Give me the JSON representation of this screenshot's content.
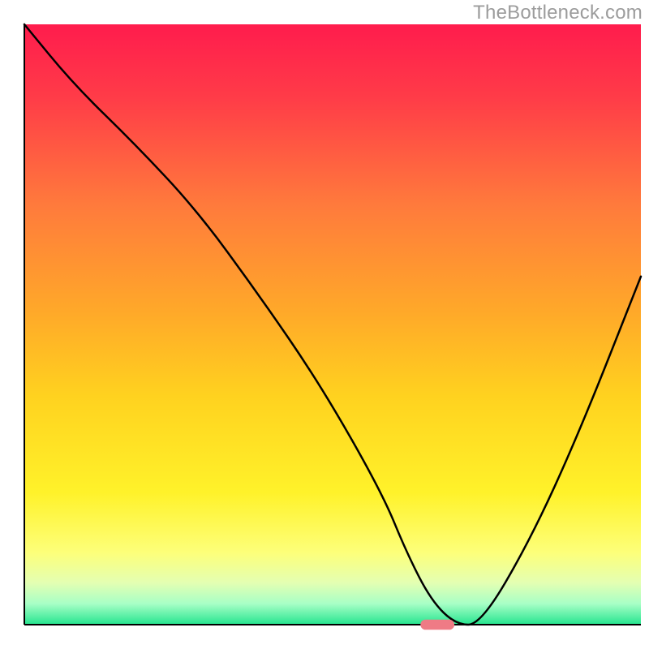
{
  "watermark": "TheBottleneck.com",
  "chart_data": {
    "type": "line",
    "title": "",
    "xlabel": "",
    "ylabel": "",
    "x_range": [
      0,
      100
    ],
    "y_range": [
      0,
      100
    ],
    "background_gradient": {
      "orientation": "vertical",
      "stops": [
        {
          "offset": 0.0,
          "color": "#ff1c4d"
        },
        {
          "offset": 0.12,
          "color": "#ff3b48"
        },
        {
          "offset": 0.3,
          "color": "#ff7a3c"
        },
        {
          "offset": 0.48,
          "color": "#ffa929"
        },
        {
          "offset": 0.62,
          "color": "#ffd21f"
        },
        {
          "offset": 0.78,
          "color": "#fff22a"
        },
        {
          "offset": 0.88,
          "color": "#fdff7a"
        },
        {
          "offset": 0.93,
          "color": "#e4ffb2"
        },
        {
          "offset": 0.965,
          "color": "#a8ffc6"
        },
        {
          "offset": 1.0,
          "color": "#25e58f"
        }
      ]
    },
    "series": [
      {
        "name": "bottleneck-curve",
        "color": "#000000",
        "x": [
          0,
          8,
          18,
          28,
          38,
          48,
          58,
          62,
          66,
          70,
          74,
          82,
          90,
          100
        ],
        "y": [
          100,
          90,
          80,
          69,
          55,
          40,
          22,
          12,
          4,
          0,
          0,
          14,
          32,
          58
        ]
      }
    ],
    "marker": {
      "name": "optimum-pill",
      "x": 67,
      "y": 0,
      "color": "#ef7b85",
      "width_frac": 0.055,
      "height_frac": 0.017
    }
  }
}
